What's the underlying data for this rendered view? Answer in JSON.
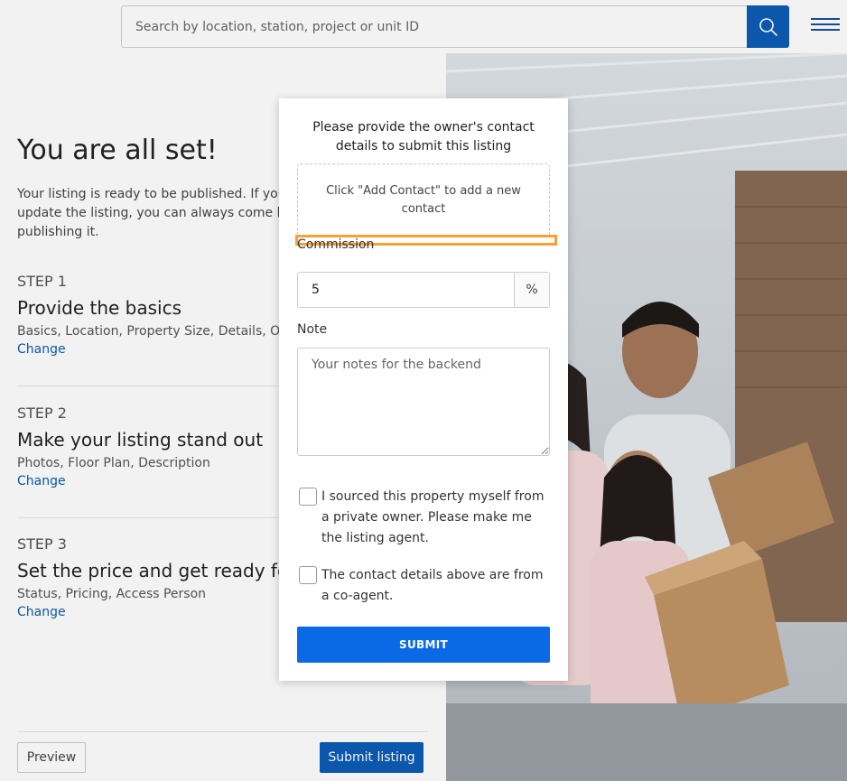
{
  "header": {
    "search_placeholder": "Search by location, station, project or unit ID",
    "search_icon": "search-icon",
    "menu_icon": "hamburger-menu-icon"
  },
  "main": {
    "title": "You are all set!",
    "intro": "Your listing is ready to be published. If you w... update the listing, you can always come back... publishing it.",
    "intro_lines": [
      "Your listing is ready to be published. If you w",
      "update the listing, you can always come back",
      "publishing it."
    ],
    "steps": [
      {
        "label": "STEP 1",
        "title": "Provide the basics",
        "desc": "Basics, Location, Property Size, Details, Owner",
        "change": "Change"
      },
      {
        "label": "STEP 2",
        "title": "Make your listing stand out",
        "desc": "Photos, Floor Plan, Description",
        "change": "Change"
      },
      {
        "label": "STEP 3",
        "title": "Set the price and get ready for v",
        "desc": "Status, Pricing, Access Person",
        "change": "Change"
      }
    ],
    "preview_label": "Preview",
    "submit_listing_label": "Submit listing"
  },
  "modal": {
    "heading": "Please provide the owner's contact details to submit this listing",
    "contact_hint": "Click \"Add Contact\" to add a new contact",
    "commission_label": "Commission",
    "commission_value": "5",
    "commission_unit": "%",
    "note_label": "Note",
    "note_placeholder": "Your notes for the backend",
    "checkbox_1": "I sourced this property myself from a private owner. Please make me the listing agent.",
    "checkbox_2": "The contact details above are from a co-agent.",
    "submit_label": "SUBMIT"
  },
  "colors": {
    "primary": "#0b5cb5",
    "modal_button": "#0a6ae6",
    "highlight": "#f7a034"
  }
}
